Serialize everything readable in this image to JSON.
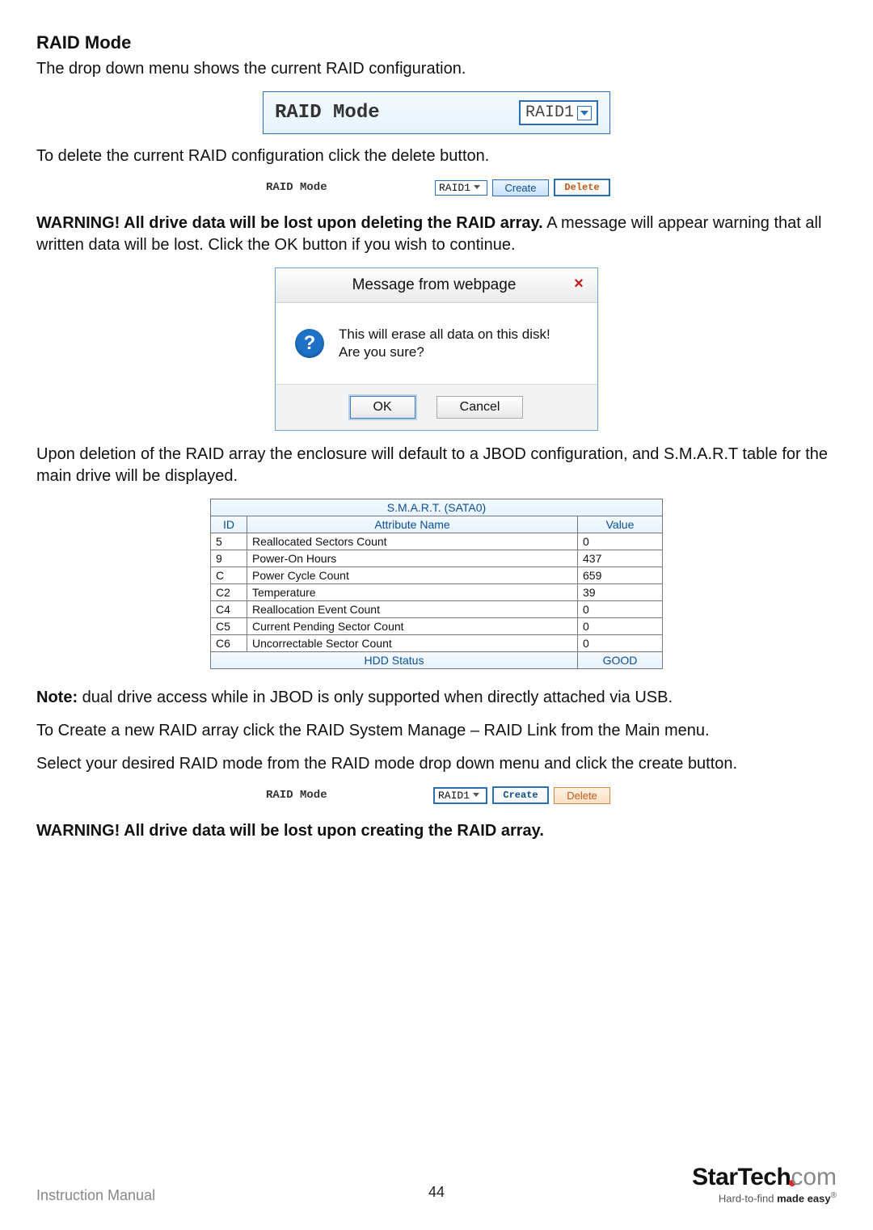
{
  "heading": "RAID Mode",
  "intro": "The drop down menu shows the current RAID configuration.",
  "fig1": {
    "label": "RAID Mode",
    "selected": "RAID1"
  },
  "delete_instr": "To delete the current RAID configuration click the delete button.",
  "row1": {
    "label": "RAID Mode",
    "selected": "RAID1",
    "create": "Create",
    "delete": "Delete"
  },
  "warn1_bold": "WARNING! All drive data will be lost upon deleting the RAID array.",
  "warn1_rest": " A message will appear warning that all written data will be lost. Click the OK button if you wish to continue.",
  "dialog": {
    "title": "Message from webpage",
    "msg1": "This will erase all data on this disk!",
    "msg2": "Are you sure?",
    "ok": "OK",
    "cancel": "Cancel"
  },
  "after_delete": "Upon deletion of the RAID array the enclosure will default to a JBOD configuration, and S.M.A.R.T table for the main drive will be displayed.",
  "smart": {
    "title": "S.M.A.R.T. (SATA0)",
    "cols": {
      "id": "ID",
      "attr": "Attribute Name",
      "val": "Value"
    },
    "rows": [
      {
        "id": "5",
        "attr": "Reallocated Sectors Count",
        "val": "0"
      },
      {
        "id": "9",
        "attr": "Power-On Hours",
        "val": "437"
      },
      {
        "id": "C",
        "attr": "Power Cycle Count",
        "val": "659"
      },
      {
        "id": "C2",
        "attr": "Temperature",
        "val": "39"
      },
      {
        "id": "C4",
        "attr": "Reallocation Event Count",
        "val": "0"
      },
      {
        "id": "C5",
        "attr": "Current Pending Sector Count",
        "val": "0"
      },
      {
        "id": "C6",
        "attr": "Uncorrectable Sector Count",
        "val": "0"
      }
    ],
    "status_label": "HDD Status",
    "status_value": "GOOD"
  },
  "note_bold": "Note:",
  "note_rest": " dual drive access while in JBOD is only supported when directly attached via USB.",
  "create_nav": "To Create a new RAID array click the RAID System Manage – RAID Link from the Main menu.",
  "create_instr": "Select your desired RAID mode from the RAID mode drop down menu and click the create button.",
  "row2": {
    "label": "RAID Mode",
    "selected": "RAID1",
    "create": "Create",
    "delete": "Delete"
  },
  "warn2": "WARNING! All drive data will be lost upon creating the RAID array.",
  "footer": {
    "manual": "Instruction Manual",
    "page": "44",
    "brand_main": "StarTech",
    "brand_dotcom": "com",
    "tagline_plain": "Hard-to-find ",
    "tagline_bold": "made easy"
  }
}
